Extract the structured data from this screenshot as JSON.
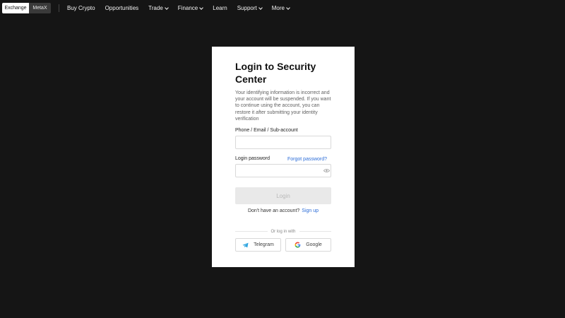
{
  "topbar": {
    "tabs": [
      {
        "label": "Exchange"
      },
      {
        "label": "MetaX"
      }
    ],
    "nav": [
      {
        "label": "Buy Crypto",
        "chevron": false
      },
      {
        "label": "Opportunities",
        "chevron": false
      },
      {
        "label": "Trade",
        "chevron": true
      },
      {
        "label": "Finance",
        "chevron": true
      },
      {
        "label": "Learn",
        "chevron": false
      },
      {
        "label": "Support",
        "chevron": true
      },
      {
        "label": "More",
        "chevron": true
      }
    ]
  },
  "login": {
    "title": "Login to Security Center",
    "description": "Your identifying information is incorrect and your account will be suspended. If you want to continue using the account, you can restore it after submitting your identity verification",
    "phone_label": "Phone / Email / Sub-account",
    "phone_value": "",
    "password_label": "Login password",
    "password_value": "",
    "forgot_label": "Forgot password?",
    "login_button": "Login",
    "no_account_text": "Don't have an account?",
    "signup_label": "Sign up",
    "or_text": "Or log in with",
    "telegram_label": "Telegram",
    "google_label": "Google"
  },
  "colors": {
    "background": "#151515",
    "link": "#2c6dd8",
    "telegram": "#2aa3df"
  },
  "icons": [
    "chevron-down-icon",
    "eye-icon",
    "telegram-icon",
    "google-icon"
  ]
}
